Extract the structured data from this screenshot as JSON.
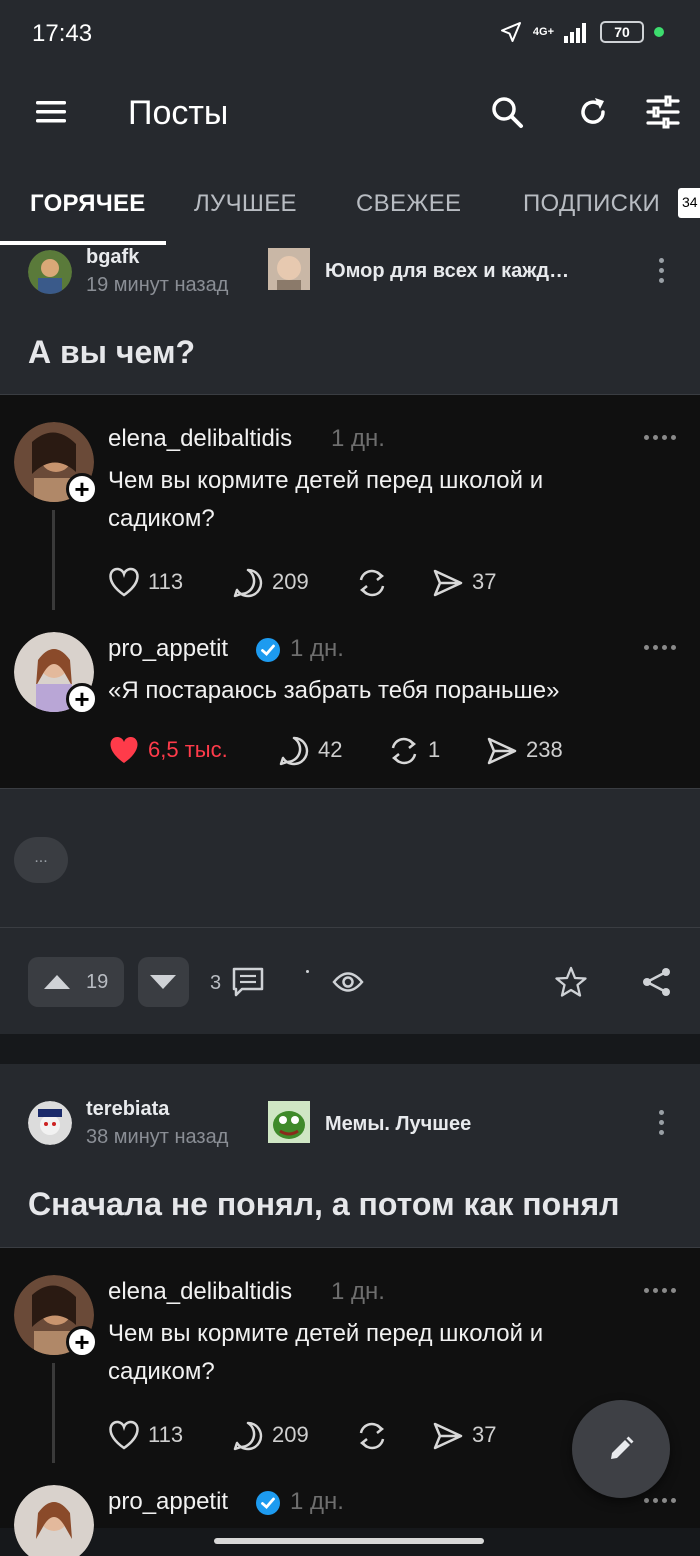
{
  "status_bar": {
    "time": "17:43",
    "network": "4G+",
    "battery": "70"
  },
  "app_bar": {
    "title": "Посты"
  },
  "tabs": [
    {
      "label": "ГОРЯЧЕЕ"
    },
    {
      "label": "ЛУЧШЕЕ"
    },
    {
      "label": "СВЕЖЕЕ"
    },
    {
      "label": "ПОДПИСКИ"
    }
  ],
  "tab_badge": "34",
  "posts": [
    {
      "author": "bgafk",
      "time_ago": "19 минут назад",
      "community": "Юмор для всех и кажд…",
      "title": "А вы чем?",
      "thread": [
        {
          "name": "elena_delibaltidis",
          "time": "1 дн.",
          "text": "Чем вы кормите детей перед школой и садиком?",
          "likes": "113",
          "comments": "209",
          "reposts": "",
          "shares": "37"
        },
        {
          "name": "pro_appetit",
          "time": "1 дн.",
          "text": "«Я постараюсь забрать тебя пораньше»",
          "likes": "6,5 тыс.",
          "comments": "42",
          "reposts": "1",
          "shares": "238"
        }
      ],
      "more_label": "...",
      "rating": "19",
      "comments_count": "3"
    },
    {
      "author": "terebiata",
      "time_ago": "38 минут назад",
      "community": "Мемы. Лучшее",
      "title": "Сначала не понял, а потом как понял",
      "thread": [
        {
          "name": "elena_delibaltidis",
          "time": "1 дн.",
          "text": "Чем вы кормите детей перед школой и садиком?",
          "likes": "113",
          "comments": "209",
          "reposts": "",
          "shares": "37"
        },
        {
          "name": "pro_appetit",
          "time": "1 дн."
        }
      ]
    }
  ],
  "colors": {
    "background": "#16181b",
    "header": "#26292e",
    "thread": "#101010",
    "liked": "#ff3b4a",
    "verified": "#1d9bf0"
  }
}
